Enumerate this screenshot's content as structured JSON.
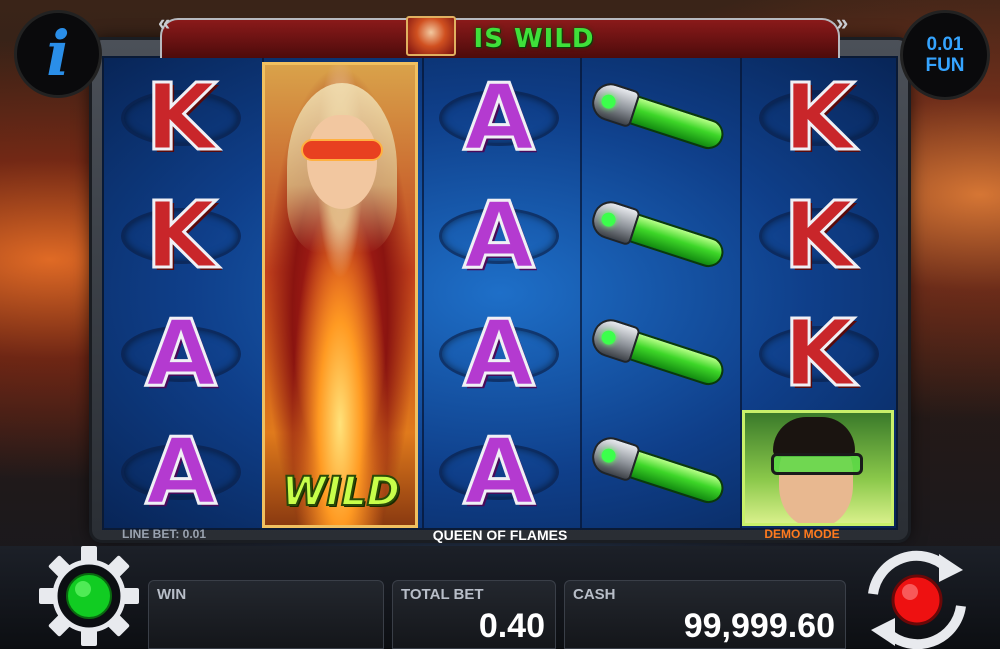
{
  "banner": {
    "text": "IS WILD"
  },
  "info_button": {
    "glyph": "i"
  },
  "fun_badge": {
    "amount": "0.01",
    "label": "FUN"
  },
  "reels": [
    {
      "symbols": [
        "K",
        "K",
        "A",
        "A"
      ]
    },
    {
      "symbols": [
        "WILD"
      ]
    },
    {
      "symbols": [
        "A",
        "A",
        "A",
        "A"
      ]
    },
    {
      "symbols": [
        "vial",
        "vial",
        "vial",
        "vial"
      ]
    },
    {
      "symbols": [
        "K",
        "K",
        "K",
        "villain"
      ]
    }
  ],
  "wild_label": "WILD",
  "footer": {
    "line_bet": "LINE BET: 0.01",
    "game_name": "QUEEN OF FLAMES",
    "demo_mode": "DEMO MODE"
  },
  "panels": {
    "win": {
      "label": "WIN",
      "value": ""
    },
    "total_bet": {
      "label": "TOTAL BET",
      "value": "0.40"
    },
    "cash": {
      "label": "CASH",
      "value": "99,999.60"
    }
  },
  "icons": {
    "settings": "gear-icon",
    "spin": "spin-arrows-icon",
    "info": "info-icon"
  },
  "colors": {
    "wild_green": "#3fe03a",
    "fun_blue": "#35a4ff",
    "demo_orange": "#ff7a1e",
    "settings_light": "#11cc22",
    "spin_light": "#ee1111"
  }
}
